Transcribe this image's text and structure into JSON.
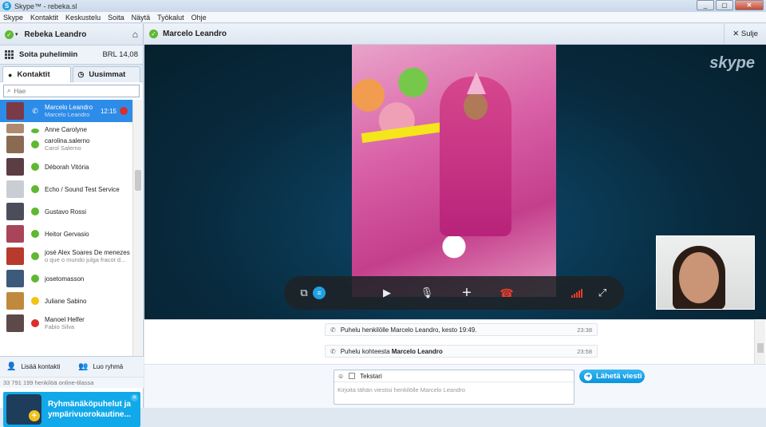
{
  "window": {
    "title": "Skype™ - rebeka.sl",
    "buttons": [
      "_",
      "▢",
      "✕"
    ]
  },
  "menu": [
    "Skype",
    "Kontaktit",
    "Keskustelu",
    "Soita",
    "Näytä",
    "Työkalut",
    "Ohje"
  ],
  "profile": {
    "name": "Rebeka Leandro",
    "status": "online",
    "status_color": "#5fb832"
  },
  "call_phones": {
    "label": "Soita puhelimiin",
    "balance": "BRL 14,08"
  },
  "tabs": [
    {
      "label": "Kontaktit",
      "icon": "person-icon",
      "active": true
    },
    {
      "label": "Uusimmat",
      "icon": "clock-icon",
      "active": false
    }
  ],
  "search": {
    "placeholder": "Hae"
  },
  "contacts": [
    {
      "name": "Marcelo Leandro",
      "sub": "Marcelo Leandro",
      "time": "12:15",
      "status": "call",
      "selected": true,
      "avatar_color": "#7a3a48"
    },
    {
      "name": "Anne Carolyne",
      "sub": "",
      "time": "",
      "status": "online",
      "selected": false,
      "avatar_color": "#b08a70"
    },
    {
      "name": "carolina.salerno",
      "sub": "Carol Salerno",
      "time": "",
      "status": "online",
      "selected": false,
      "avatar_color": "#8a6b52"
    },
    {
      "name": "Déborah Vitória",
      "sub": "",
      "time": "",
      "status": "online",
      "selected": false,
      "avatar_color": "#5b3d44"
    },
    {
      "name": "Echo / Sound Test Service",
      "sub": "",
      "time": "",
      "status": "online",
      "selected": false,
      "avatar_color": "#c9ced4"
    },
    {
      "name": "Gustavo Rossi",
      "sub": "",
      "time": "",
      "status": "online",
      "selected": false,
      "avatar_color": "#4b4e5a"
    },
    {
      "name": "Heitor Gervasio",
      "sub": "",
      "time": "",
      "status": "online",
      "selected": false,
      "avatar_color": "#a8455a"
    },
    {
      "name": "josé Alex Soares De menezes",
      "sub": "o que o mundo julga fracot d...",
      "time": "",
      "status": "online",
      "selected": false,
      "avatar_color": "#b73a2c"
    },
    {
      "name": "josetomasson",
      "sub": "",
      "time": "",
      "status": "online",
      "selected": false,
      "avatar_color": "#3c5a7a"
    },
    {
      "name": "Juliane Sabino",
      "sub": "",
      "time": "",
      "status": "away",
      "selected": false,
      "avatar_color": "#c08a3e"
    },
    {
      "name": "Manoel Helfer",
      "sub": "Fabio Silva",
      "time": "",
      "status": "dnd",
      "selected": false,
      "avatar_color": "#5d4a48"
    }
  ],
  "left_actions": {
    "add_contact": "Lisää kontakti",
    "create_group": "Luo ryhmä"
  },
  "online_count": "33 791 199 henkilöä online-tilassa",
  "promo": {
    "line1": "Ryhmänäköpuhelut ja",
    "line2": "ympärivuorokautine..."
  },
  "conversation": {
    "name": "Marcelo Leandro",
    "close_label": "Sulje",
    "skype_watermark": "skype",
    "messages": [
      {
        "prefix": "Puhelu henkilölle Marcelo Leandro, kesto 19:49.",
        "bold": "",
        "time": "23:38"
      },
      {
        "prefix": "Puhelu kohteesta ",
        "bold": "Marcelo Leandro",
        "time": "23:58"
      }
    ]
  },
  "call_controls": [
    "video-share-icon",
    "chat-icon",
    "camera-icon",
    "microphone-icon",
    "plus-icon",
    "hangup-icon",
    "signal-icon",
    "fullscreen-icon"
  ],
  "compose": {
    "text_mode_label": "Tekstari",
    "placeholder": "Kirjoita tähän viestisi henkilölle Marcelo Leandro",
    "send_label": "Lähetä viesti"
  },
  "colors": {
    "accent": "#1fa0e3",
    "selected_row": "#2d8ce8",
    "hangup": "#e83b2e",
    "online": "#5fb832",
    "away": "#f2c313",
    "busy": "#d8302b"
  }
}
